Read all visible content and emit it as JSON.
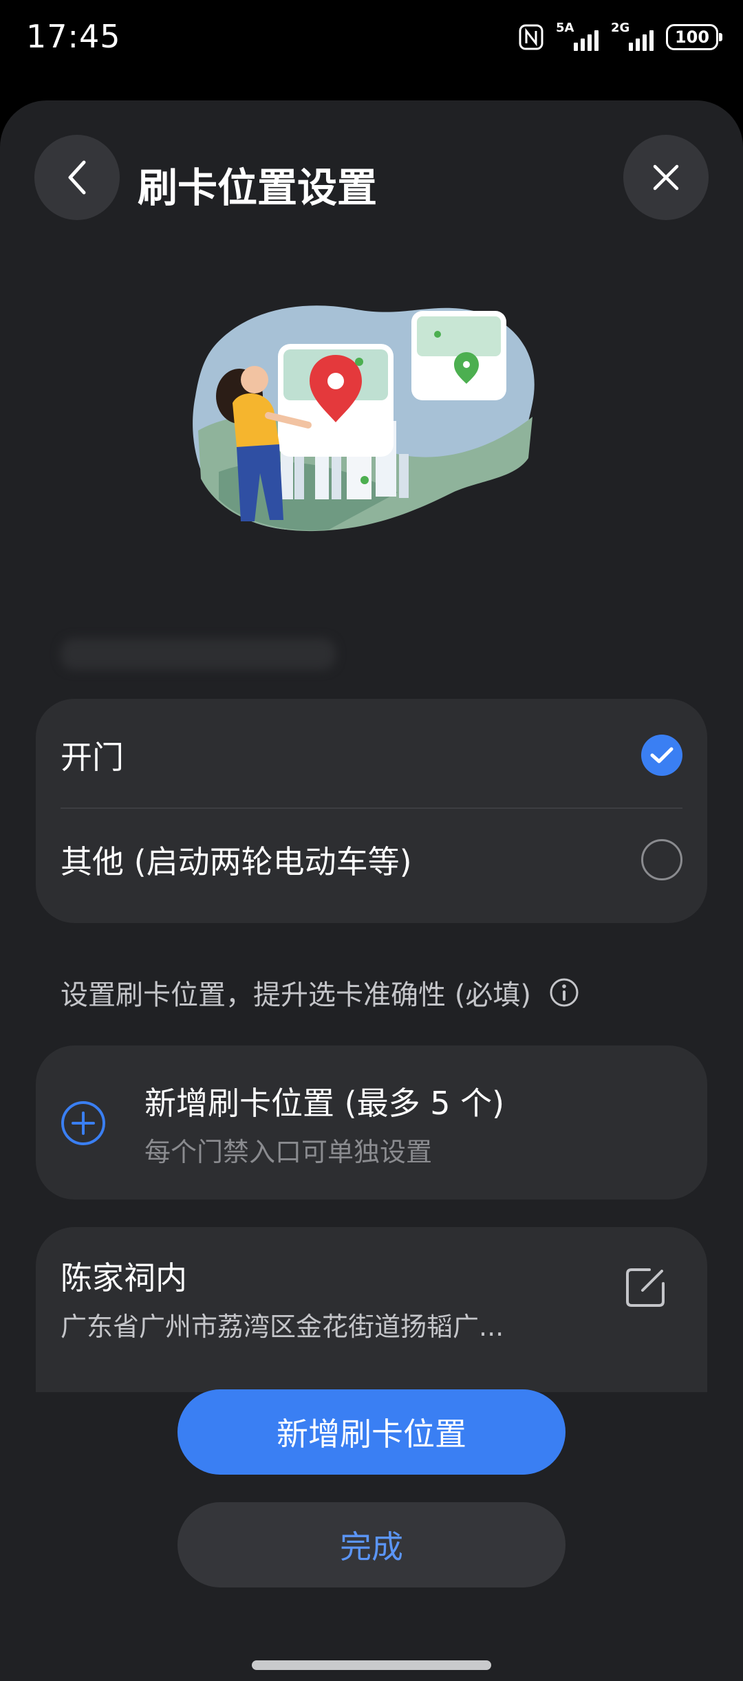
{
  "status_bar": {
    "time": "17:45",
    "nfc_icon": "nfc-icon",
    "signal1_label": "5A",
    "signal2_label": "2G",
    "battery": "100"
  },
  "header": {
    "title": "刷卡位置设置",
    "back_icon": "chevron-left-icon",
    "close_icon": "close-icon"
  },
  "purpose_options": {
    "items": [
      {
        "label": "开门",
        "selected": true
      },
      {
        "label": "其他 (启动两轮电动车等)",
        "selected": false
      }
    ]
  },
  "location_section": {
    "hint": "设置刷卡位置，提升选卡准确性 (必填)",
    "add_card": {
      "title": "新增刷卡位置 (最多 5 个)",
      "subtitle": "每个门禁入口可单独设置"
    },
    "locations": [
      {
        "name": "陈家祠内",
        "address": "广东省广州市荔湾区金花街道扬韬广..."
      }
    ]
  },
  "buttons": {
    "add_location": "新增刷卡位置",
    "done": "完成"
  },
  "colors": {
    "accent": "#3a7ff3",
    "sheet_bg": "#202124",
    "card_bg": "#2d2e31"
  }
}
